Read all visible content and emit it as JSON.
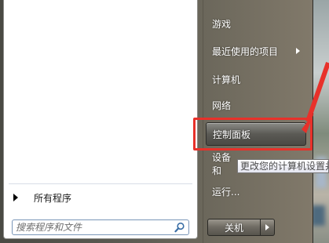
{
  "left_pane": {
    "all_programs_label": "所有程序",
    "search_placeholder": "搜索程序和文件"
  },
  "right_pane": {
    "items": [
      {
        "label": "游戏",
        "has_submenu": false
      },
      {
        "label": "最近使用的项目",
        "has_submenu": true
      },
      {
        "label": "计算机",
        "has_submenu": false
      },
      {
        "label": "网络",
        "has_submenu": false
      },
      {
        "label": "控制面板",
        "has_submenu": false,
        "highlighted": true
      },
      {
        "label": "设备和",
        "has_submenu": false
      },
      {
        "label": "运行...",
        "has_submenu": false
      }
    ]
  },
  "tooltip": {
    "text": "更改您的计算机设置并"
  },
  "shutdown": {
    "label": "关机"
  },
  "colors": {
    "annotation_red": "#e8312a",
    "menu_text": "#ffffff"
  },
  "icons": {
    "search": "search-icon",
    "submenu_arrow": "chevron-right-icon",
    "all_programs_arrow": "triangle-right-icon",
    "shutdown_options": "triangle-right-icon"
  }
}
